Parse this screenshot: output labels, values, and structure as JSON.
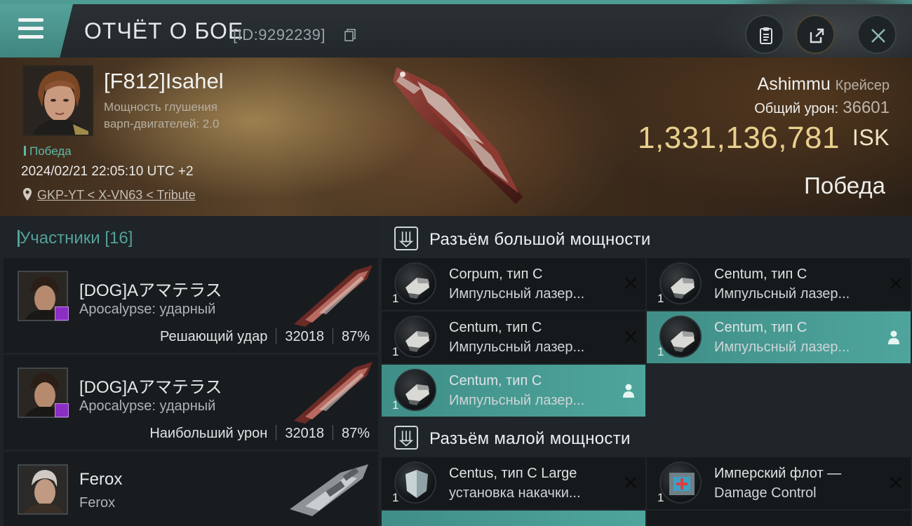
{
  "header": {
    "title": "ОТЧЁТ О БОЕ",
    "report_id": "[ID:9292239]"
  },
  "victim": {
    "pilot_name": "[F812]Isahel",
    "warp_line1": "Мощность глушения",
    "warp_line2": "варп-двигателей: 2.0",
    "result_small": "Победа",
    "datetime": "2024/02/21 22:05:10 UTC +2",
    "location": "GKP-YT < X-VN63 < Tribute",
    "ship_name": "Ashimmu",
    "ship_class": "Крейсер",
    "total_damage_label": "Общий урон:",
    "total_damage_value": "36601",
    "isk_value": "1,331,136,781",
    "isk_currency": "ISK",
    "result_big": "Победа"
  },
  "participants": {
    "title": "Участники [16]",
    "rows": [
      {
        "name": "[DOG]Aアマテラス",
        "ship": "Apocalypse: ударный",
        "label": "Решающий удар",
        "damage": "32018",
        "percent": "87%"
      },
      {
        "name": "[DOG]Aアマテラス",
        "ship": "Apocalypse: ударный",
        "label": "Наибольший урон",
        "damage": "32018",
        "percent": "87%"
      },
      {
        "name": "Ferox",
        "ship": "Ferox"
      }
    ]
  },
  "modules": {
    "high_slot_title": "Разъём большой мощности",
    "low_slot_title": "Разъём малой мощности",
    "high": [
      {
        "line1": "Corpum, тип C",
        "line2": "Импульсный лазер...",
        "qty": "1"
      },
      {
        "line1": "Centum, тип C",
        "line2": "Импульсный лазер...",
        "qty": "1"
      },
      {
        "line1": "Centum, тип C",
        "line2": "Импульсный лазер...",
        "qty": "1"
      },
      {
        "line1": "Centum, тип C",
        "line2": "Импульсный лазер...",
        "qty": "1"
      },
      {
        "line1": "Centum, тип C",
        "line2": "Импульсный лазер...",
        "qty": "1"
      }
    ],
    "low": [
      {
        "line1": "Centus, тип C Large",
        "line2": "установка накачки...",
        "qty": "1"
      },
      {
        "line1": "Имперский флот —",
        "line2": "Damage Control",
        "qty": "1"
      }
    ]
  },
  "colors": {
    "accent": "#4fa49b",
    "isk_gold": "#e9cf8e",
    "badge_purple": "#8a2ec4"
  }
}
